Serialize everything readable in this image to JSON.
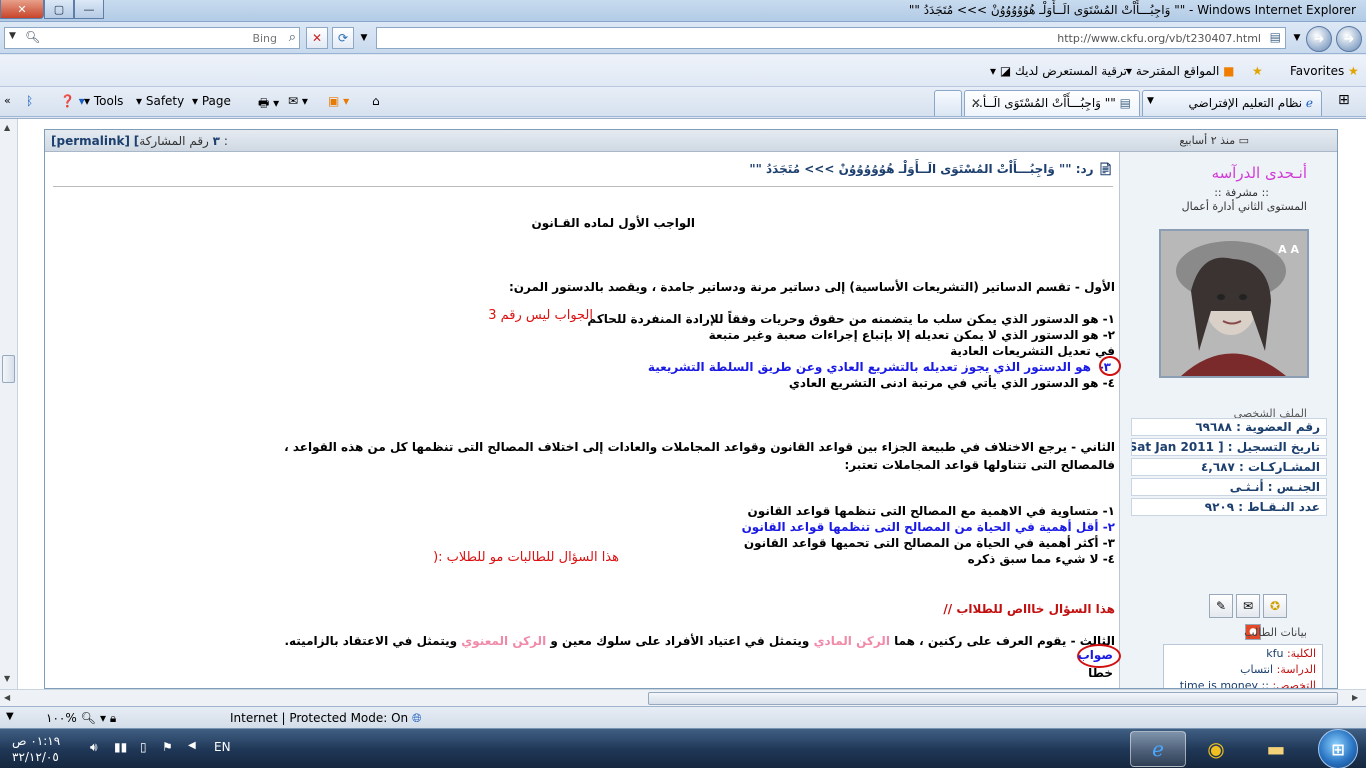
{
  "window": {
    "title": "\"\" وَاجِبُـــأَاْتْ المُسْتَوَى الَــأَوَلْـ هُوُوُوُوُوُنْ >>> مُتَجَدَدُ \"\" - Windows Internet Explorer",
    "btn_close": "✕",
    "btn_max": "▢",
    "btn_min": "—"
  },
  "addressbar": {
    "search_placeholder": "Bing",
    "url": "http://www.ckfu.org/vb/t230407.html"
  },
  "favorites": {
    "label": "Favorites",
    "suggested_sites": "المواقع المقترحة",
    "upgrade_browser": "ترقية المستعرض لديك"
  },
  "commandbar": {
    "tools": "Tools",
    "safety": "Safety",
    "page": "Page"
  },
  "tabs": [
    {
      "label": "نظام التعليم الإفتراضي"
    },
    {
      "label": "\"\" وَاجِبُـــأَاْتْ المُسْتَوَى الَــأ..."
    }
  ],
  "post": {
    "permalink_text": "[permalink]",
    "post_number_label": "رقم المشاركة :",
    "post_number": "[٣",
    "since": "منذ ٢ أسابيع",
    "reply_title": "رد: \"\" وَاجِبُـــأَاْتْ المُسْتَوَى الَــأَوَلْـ هُوُوُوُوُوُنْ >>> مُتَجَدَدُ \"\""
  },
  "user": {
    "name": "أنـحدى الدرآسه",
    "title": ":: مشرفة ::",
    "level": "المستوى الثاني أدارة أعمال",
    "avatar_text": "A A",
    "profile_title": "الملف الشخصي",
    "stats": [
      "رقم العضوية : ٦٩٦٨٨",
      "تاريخ التسجيل : [ Sat Jan 2011 ]",
      "المشـاركـات : ٤,٦٨٧",
      "الجنـس : أنـثـى",
      "عدد النـقـاط : ٩٢٠٩"
    ],
    "student_box_title": "بيانات الطالب",
    "student_college_label": "الكلية:",
    "student_college_value": "kfu",
    "student_study_label": "الدراسة:",
    "student_study_value": "انتساب",
    "student_major_label": "التخصص:",
    "student_major_value": ":: time is money"
  },
  "content": {
    "heading": "الواجب الأول لماده القـانون",
    "q1": "الأول - تقسم الدساتير (التشريعات الأساسية) إلى دساتير مرنة ودساتير جامدة ، ويقصد بالدستور المرن:",
    "q1_a1": "١- هو الدستور الذي يمكن سلب ما يتضمنه من حقوق وحريات وفقاً للإرادة المنفردة للحاكم",
    "q1_a2": "٢- هو الدستور الذي لا يمكن تعديله إلا بإتباع إجراءات صعبة وغير متبعة",
    "q1_a2b": "في تعديل التشريعات العادية",
    "q1_a3_num": "٣-",
    "q1_a3": "هو الدستور الذي يجوز تعديله بالتشريع العادي وعن طريق السلطة التشريعية",
    "q1_a4": "٤- هو الدستور الذي يأتي في مرتبة ادنى التشريع العادي",
    "note1": "الجواب ليس رقم 3",
    "q2_line1": "الثاني - يرجع الاختلاف في طبيعة الجزاء بين قواعد القانون وقواعد المجاملات والعادات إلى اختلاف المصالح التى تنظمها كل من هذه القواعد ،",
    "q2_line2": "فالمصالح التى تتناولها قواعد المجاملات تعتبر:",
    "q2_a1": "١- متساوية في الاهمية مع المصالح التى تنظمها قواعد القانون",
    "q2_a2": "٢- أقل أهمية في الحياة من المصالح التى تنظمها قواعد القانون",
    "q2_a3": "٣- أكثر أهمية في الحياة من المصالح التى تحميها قواعد القانون",
    "q2_a4": "٤- لا شيء مما سبق ذكره",
    "note2": "هذا السؤال للطالبات مو للطلاب :(",
    "note3": "هذا السؤال خاااص للطلااب //",
    "q3_prefix": "الثالث - يقوم العرف على ركنين ، هما",
    "q3_pink1": "الركن المادي",
    "q3_mid": "ويتمثل في اعتياد الأفراد على سلوك معين و",
    "q3_pink2": "الركن المعنوي",
    "q3_suffix": "ويتمثل في الاعتقاد بالزاميته.",
    "ans_true": "صواب",
    "ans_false": "خطا"
  },
  "statusbar": {
    "text": "Internet | Protected Mode: On",
    "zoom": "١٠٠%"
  },
  "taskbar": {
    "time": "٠١:١٩ ص",
    "date": "٣٢/١٢/٠٥",
    "lang": "EN"
  }
}
